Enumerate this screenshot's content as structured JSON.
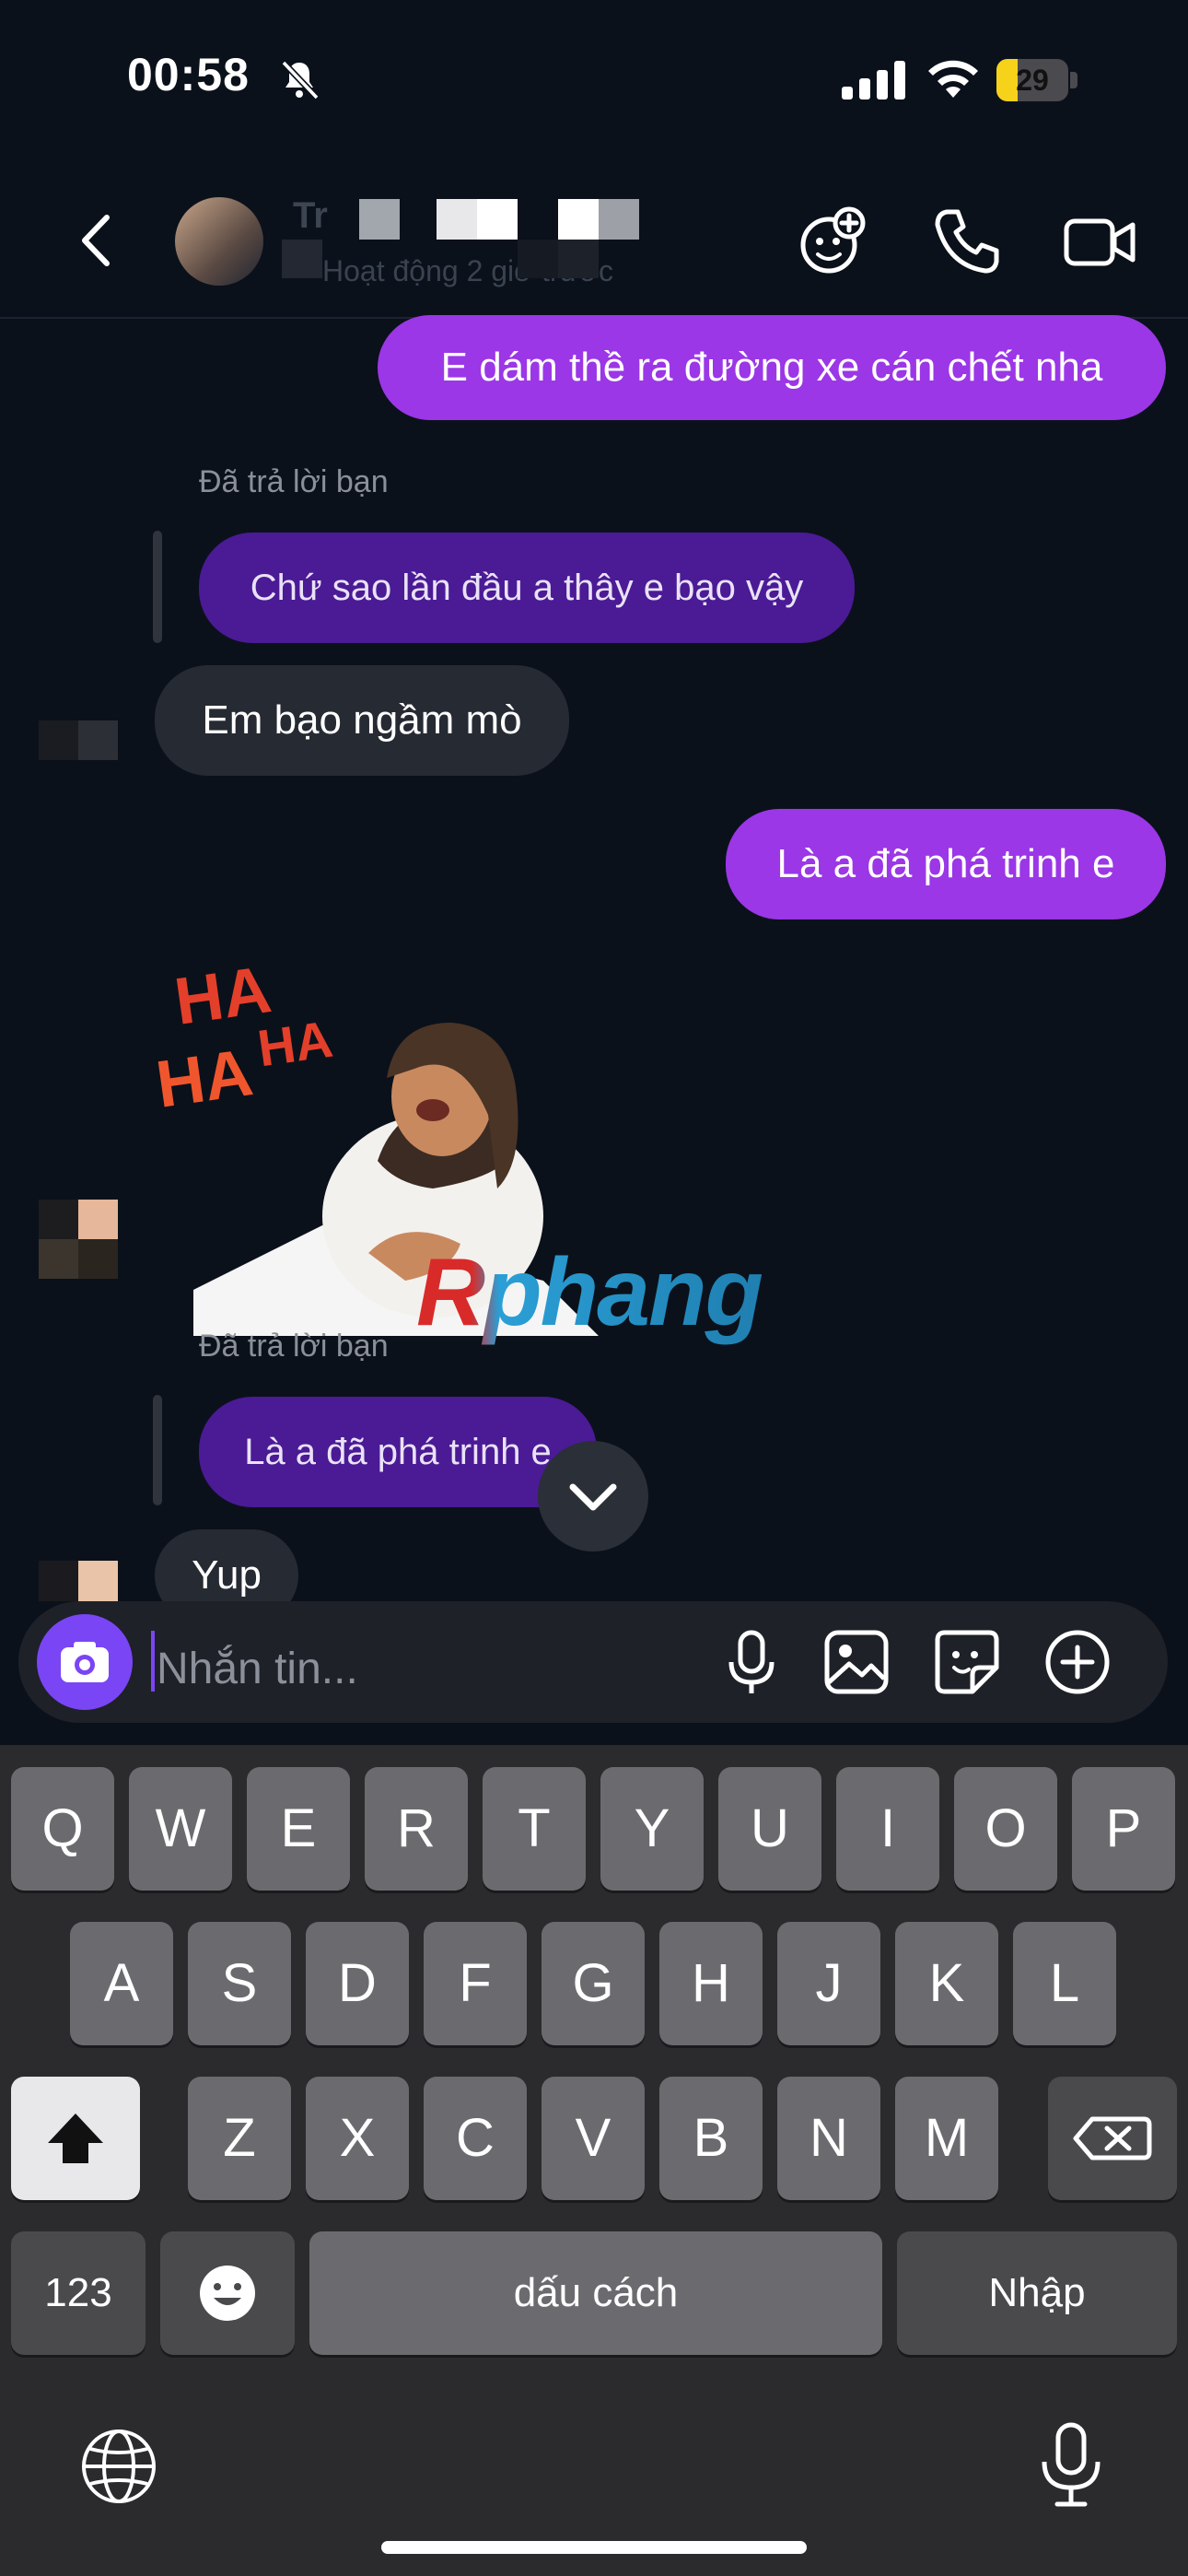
{
  "status_bar": {
    "time": "00:58",
    "battery": "29"
  },
  "header": {
    "contact_name": "Tr",
    "contact_status": "Hoạt động 2 giờ trước"
  },
  "messages": [
    {
      "type": "out",
      "text": "E dám thề ra đường xe cán chết nha"
    },
    {
      "type": "reply_label",
      "text": "Đã trả lời bạn"
    },
    {
      "type": "reply_out",
      "text": "Chứ sao lần đầu a thây e bạo vậy"
    },
    {
      "type": "in",
      "text": "Em bạo ngầm mò"
    },
    {
      "type": "out",
      "text": "Là a đã phá trinh e"
    },
    {
      "type": "sticker",
      "text_top": "HA",
      "text_mid": "HA",
      "text_low": "HA",
      "watermark": "Rphang"
    },
    {
      "type": "reply_label",
      "text": "Đã trả lời bạn"
    },
    {
      "type": "reply_out",
      "text": "Là a đã phá trinh e"
    },
    {
      "type": "in",
      "text": "Yup"
    }
  ],
  "composer": {
    "placeholder": "Nhắn tin..."
  },
  "keyboard": {
    "row1": [
      "Q",
      "W",
      "E",
      "R",
      "T",
      "Y",
      "U",
      "I",
      "O",
      "P"
    ],
    "row2": [
      "A",
      "S",
      "D",
      "F",
      "G",
      "H",
      "J",
      "K",
      "L"
    ],
    "row3": [
      "Z",
      "X",
      "C",
      "V",
      "B",
      "N",
      "M"
    ],
    "numbers_key": "123",
    "space_key": "dấu cách",
    "return_key": "Nhập"
  },
  "colors": {
    "outgoing": "#9b37e6",
    "reply_outgoing": "#4b1a95",
    "incoming": "#262a33",
    "accent": "#7a45f5"
  }
}
